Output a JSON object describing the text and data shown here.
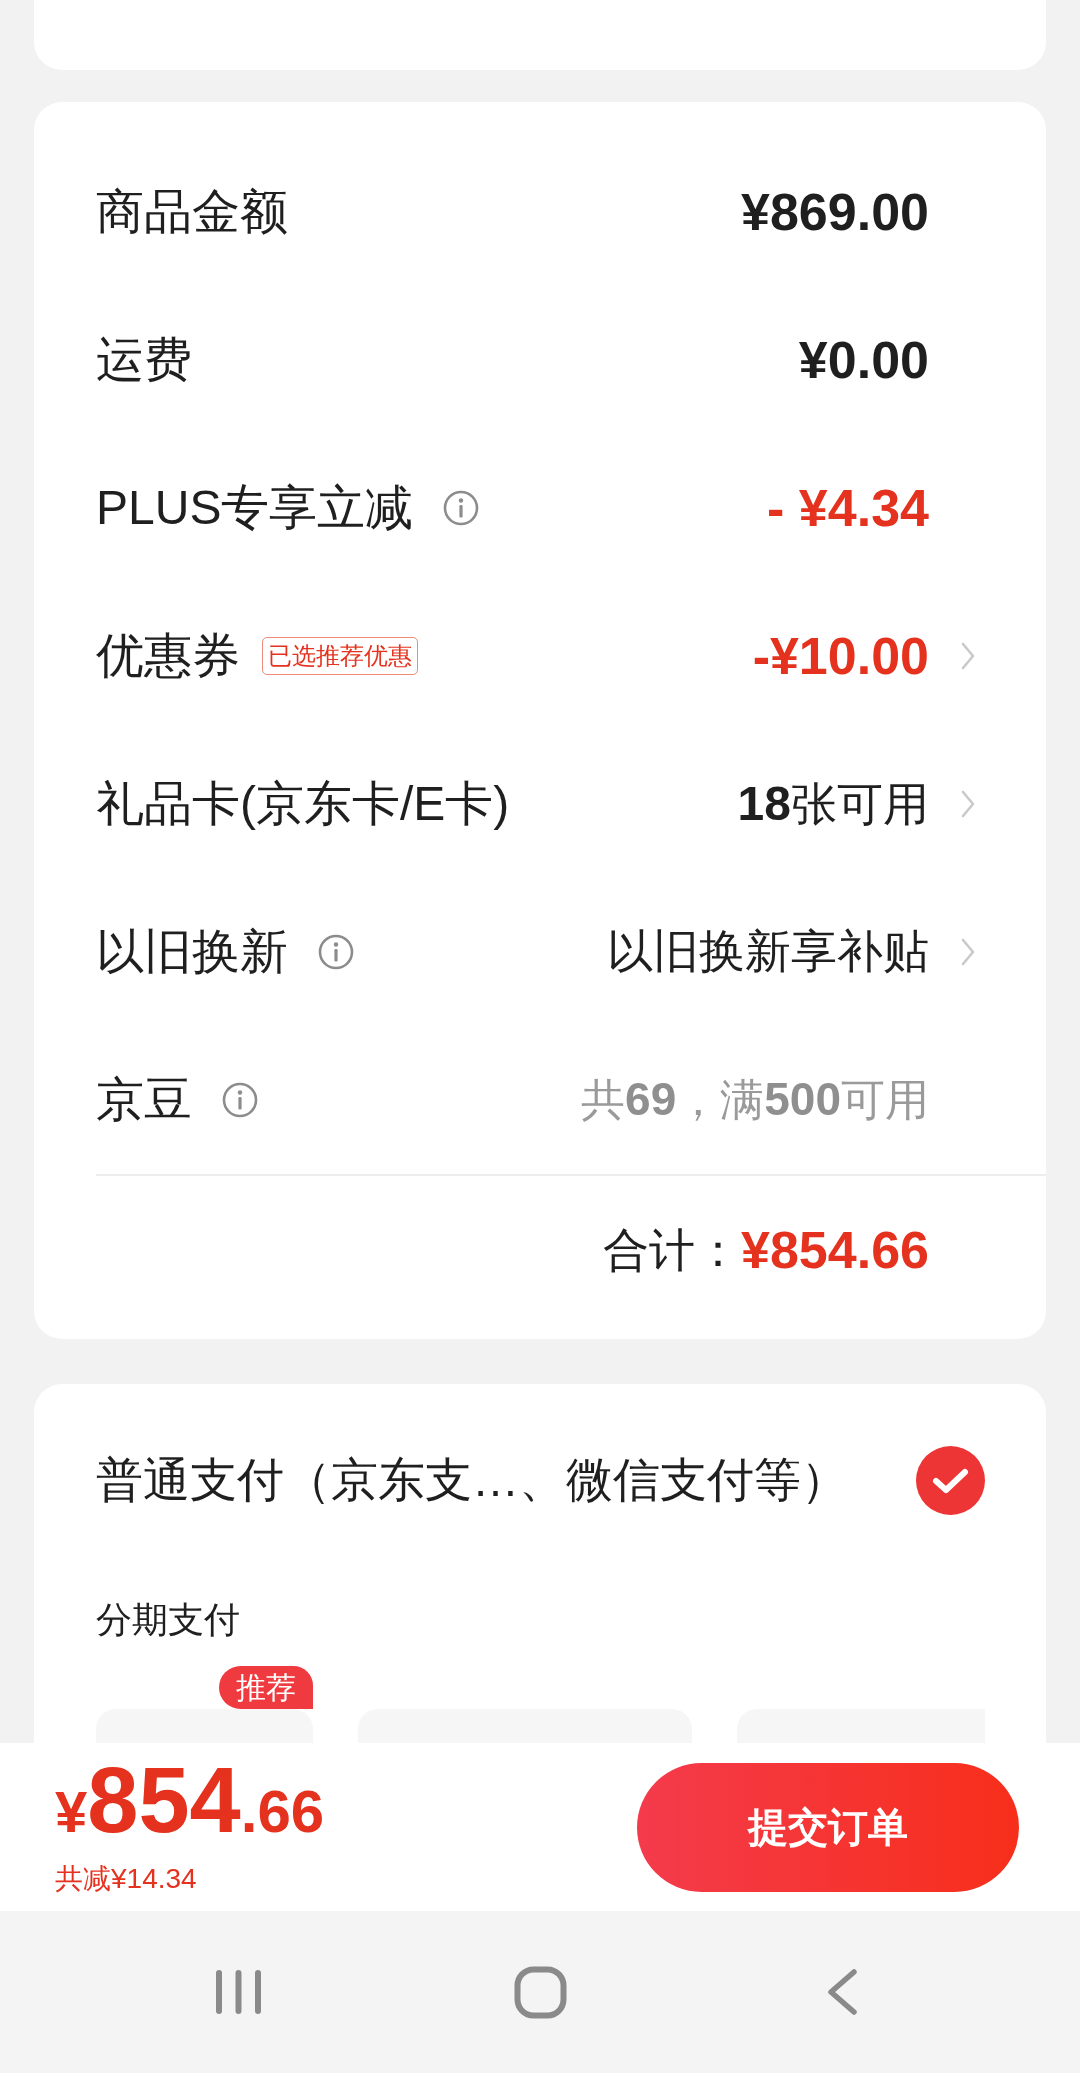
{
  "summary": {
    "rows": [
      {
        "kind": "amount",
        "label": "商品金额",
        "info": false,
        "chevron": false,
        "value": "¥869.00"
      },
      {
        "kind": "amount",
        "label": "运费",
        "info": false,
        "chevron": false,
        "value": "¥0.00"
      },
      {
        "kind": "discount",
        "label": "PLUS专享立减",
        "info": true,
        "chevron": false,
        "value": "- ¥4.34"
      },
      {
        "kind": "discount",
        "label": "优惠券",
        "badge": "已选推荐优惠",
        "info": false,
        "chevron": true,
        "value": "-¥10.00"
      },
      {
        "kind": "option",
        "label": "礼品卡(京东卡/E卡)",
        "info": false,
        "chevron": true,
        "value": "**18**张可用"
      },
      {
        "kind": "option",
        "label": "以旧换新",
        "info": true,
        "chevron": true,
        "value": "以旧换新享补贴"
      },
      {
        "kind": "hint",
        "label": "京豆",
        "info": true,
        "chevron": false,
        "value": "共**69**，满**500**可用"
      }
    ],
    "total": {
      "label": "合计：",
      "value": "¥854.66"
    }
  },
  "payment": {
    "options": [
      {
        "label": "普通支付（京东支…、微信支付等）",
        "selected": true
      }
    ],
    "installment": {
      "title": "分期支付",
      "badge": "推荐",
      "plans": [
        {
          "recommended": true
        },
        {
          "recommended": false
        },
        {
          "recommended": false
        }
      ]
    }
  },
  "footer": {
    "currency": "¥",
    "price_integer": "854",
    "price_decimal": ".66",
    "savings": "共减¥14.34",
    "submit": "提交订单"
  }
}
